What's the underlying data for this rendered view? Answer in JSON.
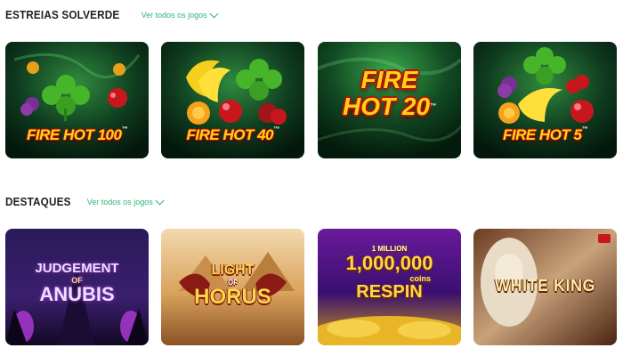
{
  "sections": [
    {
      "title": "ESTREIAS SOLVERDE",
      "see_all": "Ver todos os jogos",
      "games": [
        {
          "title": "FIRE HOT 100",
          "tm": "™"
        },
        {
          "title": "FIRE HOT 40",
          "tm": "™"
        },
        {
          "title_line1": "FIRE",
          "title_line2": "HOT 20",
          "tm": "™"
        },
        {
          "title": "FIRE HOT 5",
          "tm": "™"
        }
      ]
    },
    {
      "title": "DESTAQUES",
      "see_all": "Ver todos os jogos",
      "games": [
        {
          "title_line1": "JUDGEMENT",
          "title_small": "OF",
          "title_line2": "ANUBIS"
        },
        {
          "title_line1": "LIGHT",
          "title_small": "OF",
          "title_line2": "HORUS"
        },
        {
          "title_top": "1 MILLION",
          "title_line1": "1,000,000",
          "title_small": "coins",
          "title_line2": "RESPIN"
        },
        {
          "title": "WHITE KING"
        }
      ]
    }
  ],
  "colors": {
    "accent": "#2bb673",
    "heading": "#1f1f1f"
  }
}
